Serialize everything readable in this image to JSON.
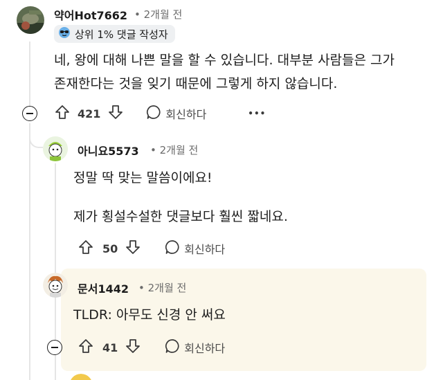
{
  "comments": [
    {
      "username": "약어Hot7662",
      "time": "• 2개월 전",
      "badge": {
        "icon": "sunglasses-icon",
        "label": "상위 1% 댓글 작성자"
      },
      "lines": [
        "네, 왕에 대해 나쁜 말을 할 수 있습니다. 대부분 사람들은 그가",
        "존재한다는 것을 잊기 때문에 그렇게 하지 않습니다."
      ],
      "votes": "421",
      "reply_label": "회신하다",
      "more": "•••"
    },
    {
      "username": "아니요5573",
      "time": "• 2개월 전",
      "lines": [
        "정말 딱 맞는 말씀이에요!",
        "제가 횡설수설한 댓글보다 훨씬 짧네요."
      ],
      "votes": "50",
      "reply_label": "회신하다"
    },
    {
      "username": "문서1442",
      "time": "• 2개월 전",
      "lines": [
        "TLDR: 아무도 신경 안 써요"
      ],
      "votes": "41",
      "reply_label": "회신하다",
      "highlight_color": "#fbf7ea"
    }
  ]
}
